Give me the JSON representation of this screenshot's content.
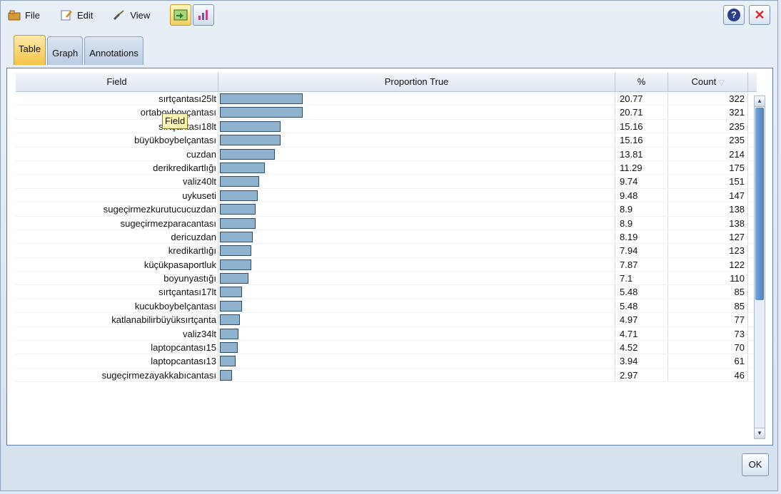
{
  "menu": {
    "file": "File",
    "edit": "Edit",
    "view": "View"
  },
  "tabs": [
    {
      "label": "Table"
    },
    {
      "label": "Graph"
    },
    {
      "label": "Annotations"
    }
  ],
  "table": {
    "headers": {
      "field": "Field",
      "proportion": "Proportion True",
      "pct": "%",
      "count": "Count"
    },
    "rows": [
      {
        "field": "sırtçantası25lt",
        "pct": "20.77",
        "count": "322",
        "proportion": 20.77
      },
      {
        "field": "ortaboyboyçantası",
        "pct": "20.71",
        "count": "321",
        "proportion": 20.71
      },
      {
        "field": "sırtçantası18lt",
        "pct": "15.16",
        "count": "235",
        "proportion": 15.16
      },
      {
        "field": "büyükboybelçantası",
        "pct": "15.16",
        "count": "235",
        "proportion": 15.16
      },
      {
        "field": "cuzdan",
        "pct": "13.81",
        "count": "214",
        "proportion": 13.81
      },
      {
        "field": "derikredikartlığı",
        "pct": "11.29",
        "count": "175",
        "proportion": 11.29
      },
      {
        "field": "valiz40lt",
        "pct": "9.74",
        "count": "151",
        "proportion": 9.74
      },
      {
        "field": "uykuseti",
        "pct": "9.48",
        "count": "147",
        "proportion": 9.48
      },
      {
        "field": "sugeçirmezkurutucucuzdan",
        "pct": "8.9",
        "count": "138",
        "proportion": 8.9
      },
      {
        "field": "sugeçirmezparacantası",
        "pct": "8.9",
        "count": "138",
        "proportion": 8.9
      },
      {
        "field": "dericuzdan",
        "pct": "8.19",
        "count": "127",
        "proportion": 8.19
      },
      {
        "field": "kredikartlığı",
        "pct": "7.94",
        "count": "123",
        "proportion": 7.94
      },
      {
        "field": "küçükpasaportluk",
        "pct": "7.87",
        "count": "122",
        "proportion": 7.87
      },
      {
        "field": "boyunyastığı",
        "pct": "7.1",
        "count": "110",
        "proportion": 7.1
      },
      {
        "field": "sırtçantası17lt",
        "pct": "5.48",
        "count": "85",
        "proportion": 5.48
      },
      {
        "field": "kucukboybelçantası",
        "pct": "5.48",
        "count": "85",
        "proportion": 5.48
      },
      {
        "field": "katlanabilirbüyüksırtçanta",
        "pct": "4.97",
        "count": "77",
        "proportion": 4.97
      },
      {
        "field": "valiz34lt",
        "pct": "4.71",
        "count": "73",
        "proportion": 4.71
      },
      {
        "field": "laptopcantası15",
        "pct": "4.52",
        "count": "70",
        "proportion": 4.52
      },
      {
        "field": "laptopcantası13",
        "pct": "3.94",
        "count": "61",
        "proportion": 3.94
      },
      {
        "field": "sugeçirmezayakkabıcantası",
        "pct": "2.97",
        "count": "46",
        "proportion": 2.97
      }
    ]
  },
  "tooltip": "Field",
  "ok_label": "OK",
  "help_symbol": "?",
  "close_symbol": "✕",
  "colors": {
    "bar_fill": "#8fb3cf",
    "bar_border": "#2e4c66",
    "active_tab": "#f6c445",
    "close_red": "#d9262e"
  }
}
